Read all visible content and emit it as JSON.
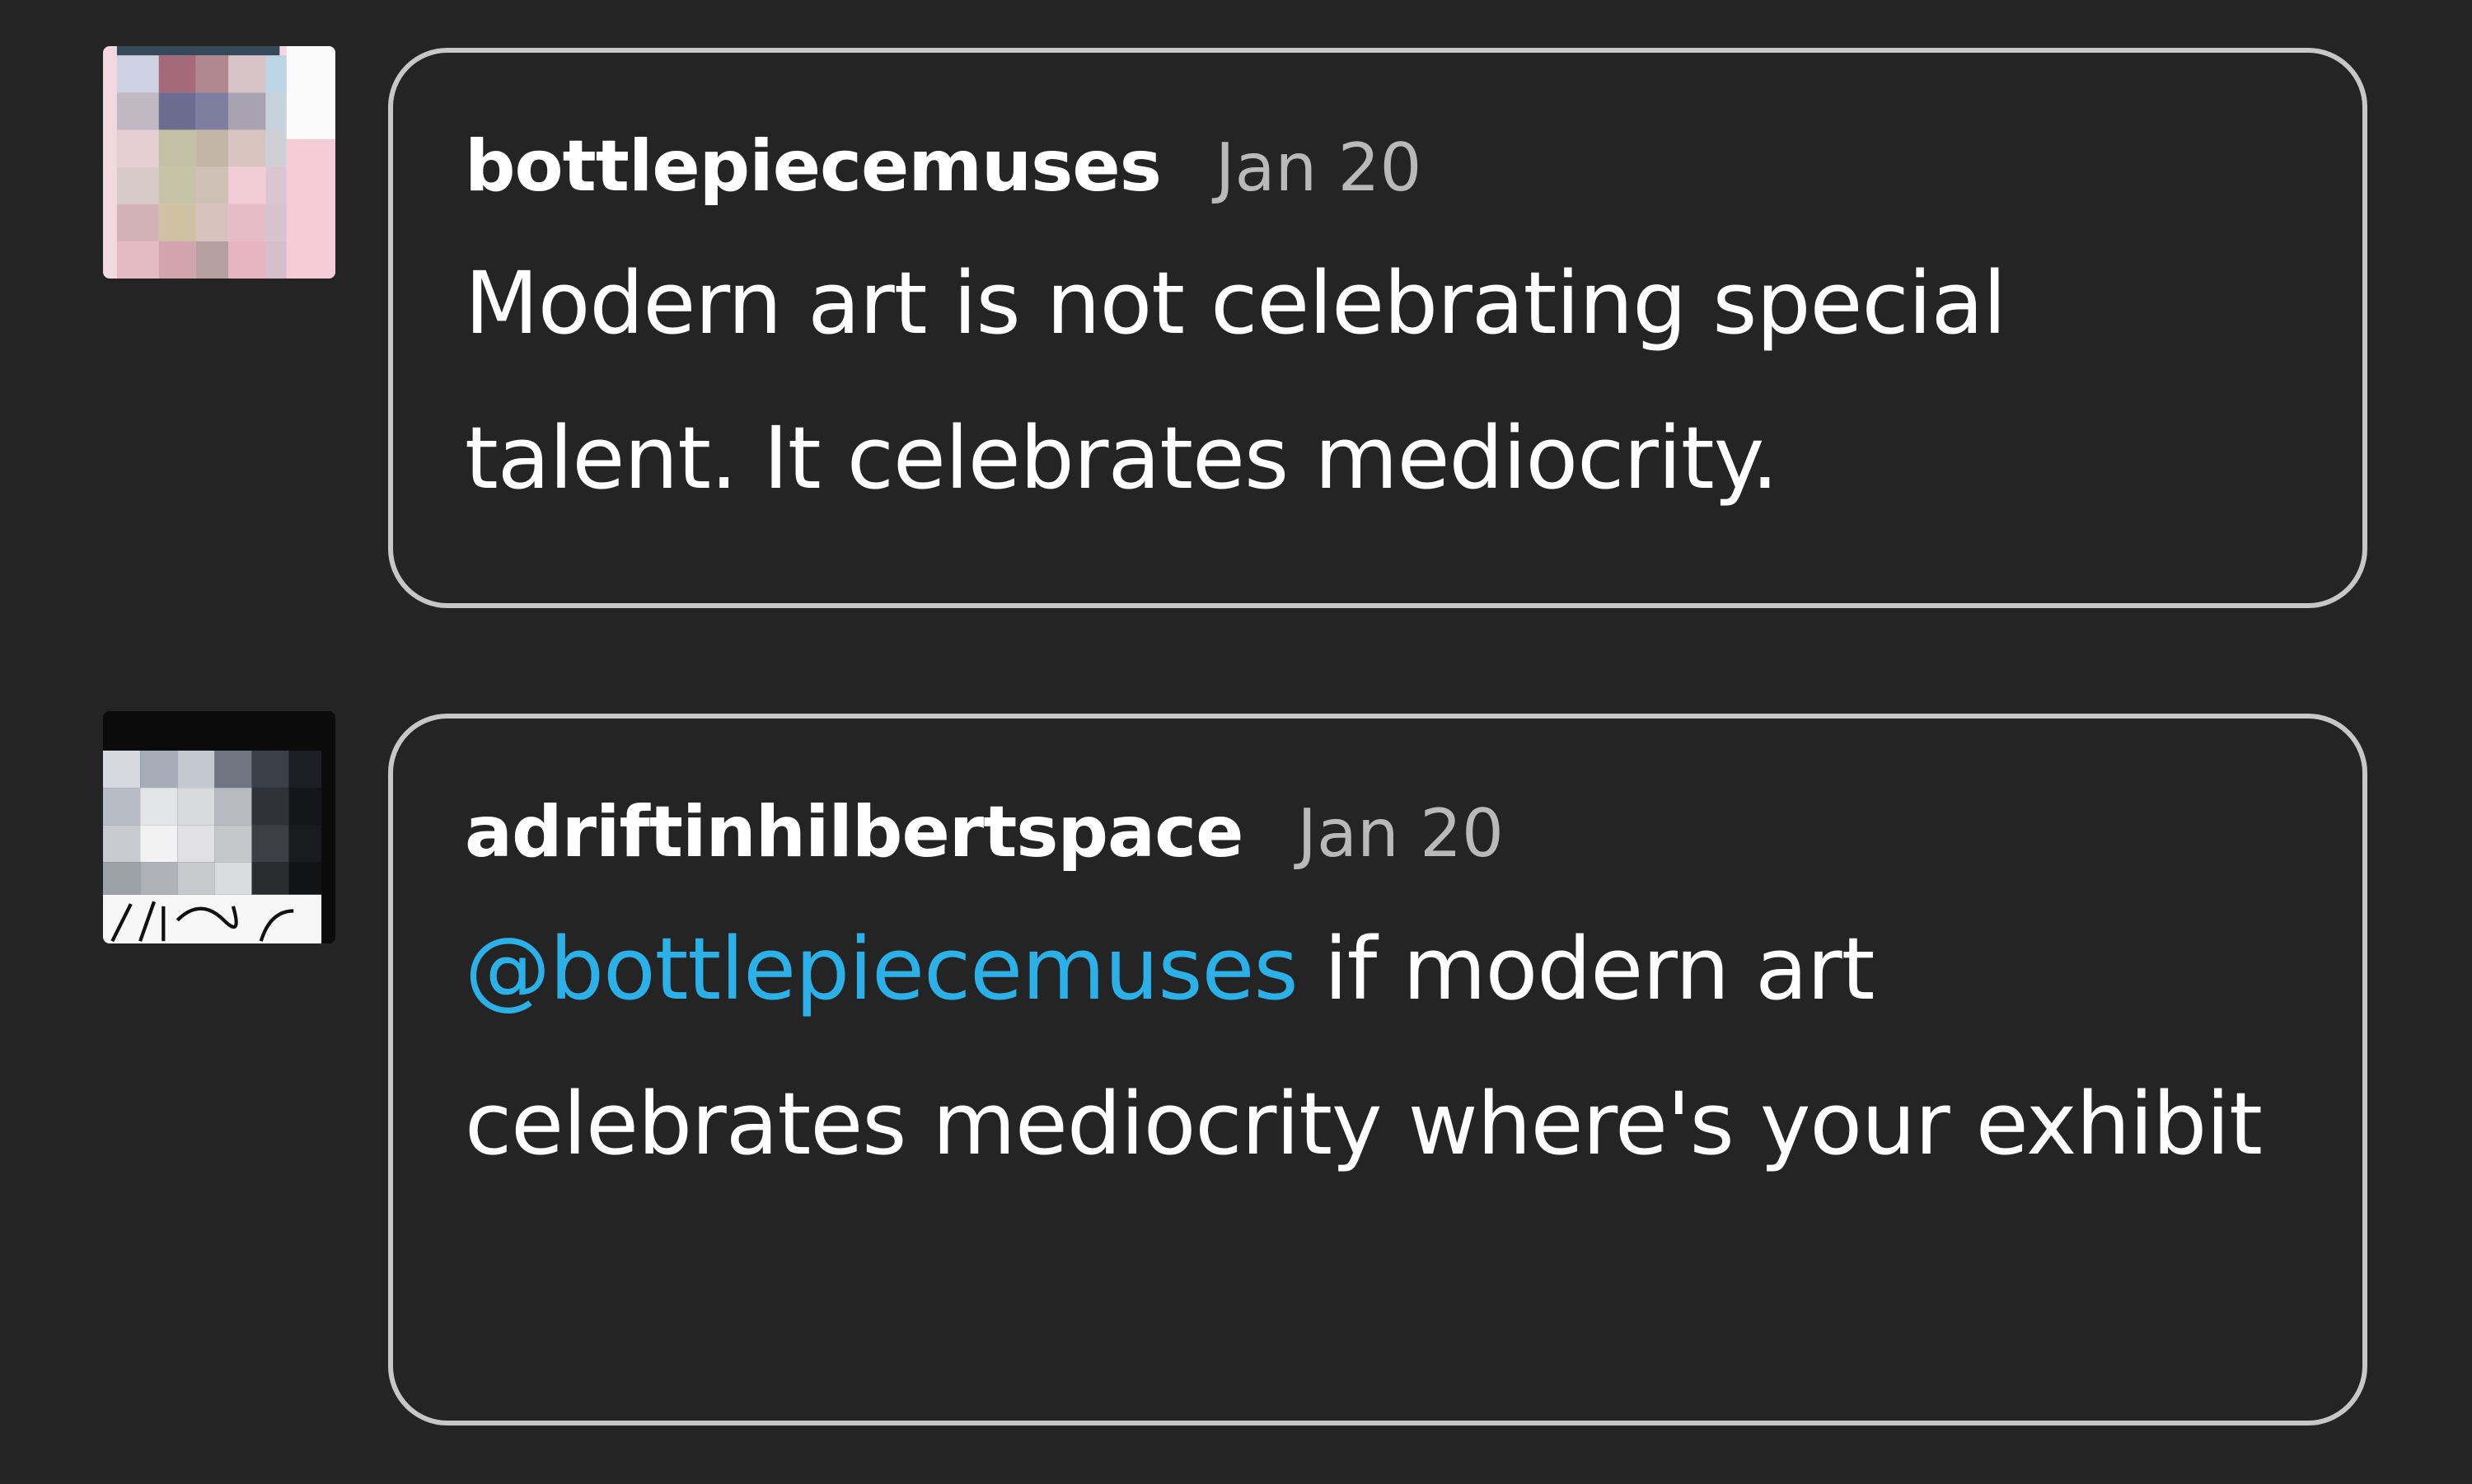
{
  "comments": [
    {
      "username": "bottlepiecemuses",
      "date": "Jan 20",
      "text": "Modern art is not celebrating special talent. It celebrates mediocrity."
    },
    {
      "username": "adriftinhilbertspace",
      "date": "Jan 20",
      "mention": "@bottlepiecemuses",
      "text": " if modern art celebrates mediocrity where's your exhibit"
    }
  ],
  "colors": {
    "background": "#242424",
    "bubble_border": "#c7c7c7",
    "mention": "#2bb0e8"
  }
}
